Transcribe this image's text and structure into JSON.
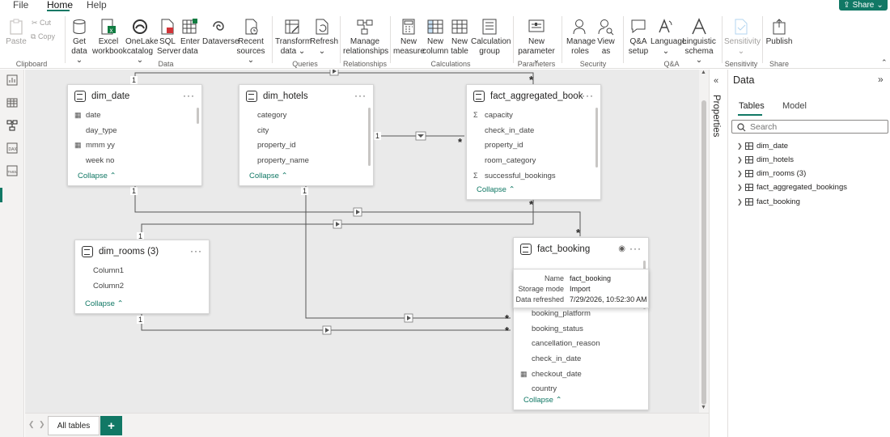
{
  "menu": {
    "file": "File",
    "home": "Home",
    "help": "Help"
  },
  "share": {
    "label": "Share"
  },
  "ribbon": {
    "clipboard": {
      "paste": "Paste",
      "cut": "Cut",
      "copy": "Copy",
      "group": "Clipboard"
    },
    "data": {
      "get_data": "Get data",
      "excel": "Excel workbook",
      "onelake": "OneLake catalog",
      "sql": "SQL Server",
      "enter": "Enter data",
      "dataverse": "Dataverse",
      "recent": "Recent sources",
      "group": "Data"
    },
    "queries": {
      "transform": "Transform data",
      "refresh": "Refresh",
      "group": "Queries"
    },
    "relationships": {
      "manage": "Manage relationships",
      "group": "Relationships"
    },
    "calculations": {
      "measure": "New measure",
      "column": "New column",
      "table": "New table",
      "calc_group": "Calculation group",
      "group": "Calculations"
    },
    "parameters": {
      "new_param": "New parameter",
      "group": "Parameters"
    },
    "security": {
      "manage_roles": "Manage roles",
      "view_as": "View as",
      "group": "Security"
    },
    "qa": {
      "setup": "Q&A setup",
      "language": "Language",
      "linguistic": "Linguistic schema",
      "group": "Q&A"
    },
    "sensitivity": {
      "label": "Sensitivity",
      "group": "Sensitivity"
    },
    "share": {
      "publish": "Publish",
      "group": "Share"
    }
  },
  "tables": {
    "dim_date": {
      "title": "dim_date",
      "fields": [
        "date",
        "day_type",
        "mmm yy",
        "week no"
      ],
      "collapse": "Collapse"
    },
    "dim_hotels": {
      "title": "dim_hotels",
      "fields": [
        "category",
        "city",
        "property_id",
        "property_name"
      ],
      "collapse": "Collapse"
    },
    "fact_agg": {
      "title": "fact_aggregated_booki...",
      "fields": [
        "capacity",
        "check_in_date",
        "property_id",
        "room_category",
        "successful_bookings"
      ],
      "collapse": "Collapse"
    },
    "dim_rooms": {
      "title": "dim_rooms (3)",
      "fields": [
        "Column1",
        "Column2"
      ],
      "collapse": "Collapse"
    },
    "fact_booking": {
      "title": "fact_booking",
      "fields": [
        "booking_platform",
        "booking_status",
        "cancellation_reason",
        "check_in_date",
        "checkout_date",
        "country"
      ],
      "collapse": "Collapse"
    }
  },
  "cardinality": {
    "one": "1",
    "many": "*"
  },
  "tooltip": {
    "name_label": "Name",
    "name_value": "fact_booking",
    "storage_label": "Storage mode",
    "storage_value": "Import",
    "refreshed_label": "Data refreshed",
    "refreshed_value": "7/29/2026, 10:52:30 AM"
  },
  "tabs": {
    "all_tables": "All tables",
    "add": "+"
  },
  "properties": {
    "label": "Properties"
  },
  "data_pane": {
    "title": "Data",
    "tab_tables": "Tables",
    "tab_model": "Model",
    "search_placeholder": "Search",
    "items": [
      "dim_date",
      "dim_hotels",
      "dim_rooms (3)",
      "fact_aggregated_bookings",
      "fact_booking"
    ]
  },
  "colors": {
    "accent": "#117865"
  }
}
